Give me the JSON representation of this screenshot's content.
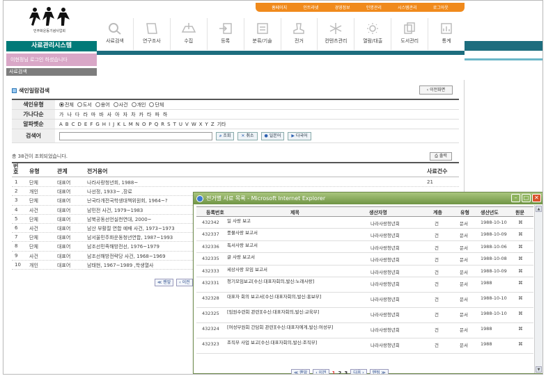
{
  "header": {
    "top_links": [
      "홈페이지",
      "인트라넷",
      "경영정보",
      "인명관리",
      "시스템관리",
      "로그아웃"
    ],
    "logo_caption": "민주화운동기념사업회",
    "system_title": "사료관리시스템",
    "welcome": "이현정님 로그인 하셨습니다",
    "sub_title": "사료검색",
    "nav_items": [
      {
        "label": "사료검색",
        "icon": "magnifier-icon"
      },
      {
        "label": "연구조사",
        "icon": "book-icon"
      },
      {
        "label": "수집",
        "icon": "tray-icon"
      },
      {
        "label": "등록",
        "icon": "import-icon"
      },
      {
        "label": "분류/기술",
        "icon": "sort-icon"
      },
      {
        "label": "전거",
        "icon": "stamp-icon"
      },
      {
        "label": "컨텐츠관리",
        "icon": "snowflake-icon"
      },
      {
        "label": "열람/대출",
        "icon": "sun-icon"
      },
      {
        "label": "도서관리",
        "icon": "books-icon"
      },
      {
        "label": "통계",
        "icon": "chart-icon"
      }
    ]
  },
  "search": {
    "section_title": "색인일람검색",
    "prev_button": "이전화면",
    "type_label": "색인유형",
    "type_options": [
      "전체",
      "도서",
      "용어",
      "사건",
      "개인",
      "단체"
    ],
    "hangul_label": "가나다순",
    "hangul": [
      "가",
      "나",
      "다",
      "라",
      "마",
      "바",
      "사",
      "아",
      "자",
      "차",
      "카",
      "타",
      "파",
      "하"
    ],
    "alpha_label": "알파벳순",
    "alpha": [
      "A",
      "B",
      "C",
      "D",
      "E",
      "F",
      "G",
      "H",
      "I",
      "J",
      "K",
      "L",
      "M",
      "N",
      "O",
      "P",
      "Q",
      "R",
      "S",
      "T",
      "U",
      "V",
      "W",
      "X",
      "Y",
      "Z",
      "기타"
    ],
    "keyword_label": "검색어",
    "buttons": [
      "조회",
      "취소",
      "일본어",
      "다국어"
    ]
  },
  "results": {
    "count_text": "총 38건이 조회되었습니다.",
    "print_button": "출력",
    "headers": [
      "번호",
      "유형",
      "관계",
      "전거용어",
      "사료건수"
    ],
    "rows": [
      [
        "1",
        "단체",
        "대표어",
        "나라사랑청년회, 1988~",
        "21"
      ],
      [
        "2",
        "개인",
        "대표어",
        "나선정, 1933~ ,장로",
        ""
      ],
      [
        "3",
        "단체",
        "대표어",
        "난국타개전국학생대책위원회, 1964~?",
        ""
      ],
      [
        "4",
        "사건",
        "대표어",
        "남민전 사건, 1979~1983",
        ""
      ],
      [
        "5",
        "단체",
        "대표어",
        "남북공동선언실천연대, 2000~",
        ""
      ],
      [
        "6",
        "사건",
        "대표어",
        "남산 부활절 연합 예배 사건, 1973~1973",
        ""
      ],
      [
        "7",
        "단체",
        "대표어",
        "남서울민주화운동청년연합, 1987~1993",
        ""
      ],
      [
        "8",
        "단체",
        "대표어",
        "남조선민족해방전선, 1976~1979",
        ""
      ],
      [
        "9",
        "사건",
        "대표어",
        "남조선해방전략당 사건, 1968~1969",
        ""
      ],
      [
        "10",
        "개인",
        "대표어",
        "남태현, 1967~1989 ,학생열사",
        ""
      ]
    ],
    "pager": [
      "맨앞",
      "이전"
    ]
  },
  "popup": {
    "title": "전거별 사료 목록 - Microsoft Internet Explorer",
    "headers": [
      "등록번호",
      "제목",
      "생산자명",
      "계층",
      "유형",
      "생산년도",
      "원문"
    ],
    "rows": [
      [
        "432342",
        "일 사랑 보고",
        "나라사랑청년회",
        "건",
        "문서",
        "1988-10-10",
        "⌘"
      ],
      [
        "432337",
        "풍물사랑 보고서",
        "나라사랑청년회",
        "건",
        "문서",
        "1988-10-09",
        "⌘"
      ],
      [
        "432336",
        "독서사랑 보고서",
        "나라사랑청년회",
        "건",
        "문서",
        "1988-10-06",
        "⌘"
      ],
      [
        "432335",
        "글 사랑 보고서",
        "나라사랑청년회",
        "건",
        "문서",
        "1988-10-08",
        "⌘"
      ],
      [
        "432333",
        "세상사랑 모임 보고서",
        "나라사랑청년회",
        "건",
        "문서",
        "1988-10-09",
        "⌘"
      ],
      [
        "432331",
        "청기모임보고[수신:대표자회의,발신:노래사랑]",
        "나라사랑청년회",
        "건",
        "문서",
        "1988",
        "⌘"
      ],
      [
        "432328",
        "대표자 회의 보고서[수신:대표자회의,발신:홍보부]",
        "나라사랑청년회",
        "건",
        "문서",
        "1988-10-10",
        "⌘"
      ],
      [
        "432325",
        "[임원수련회 관련][수신:대표자회의,발신:교육부]",
        "나라사랑청년회",
        "건",
        "문서",
        "1988-10-10",
        "⌘"
      ],
      [
        "432324",
        "[여성부원회 간담회 관련][수신:대표자에게,발신:여성부]",
        "나라사랑청년회",
        "건",
        "문서",
        "1988",
        "⌘"
      ],
      [
        "432323",
        "조직부 사업 보고[수신:대표자회의,발신:조직부]",
        "나라사랑청년회",
        "건",
        "문서",
        "1988",
        "⌘"
      ]
    ],
    "pager": {
      "first": "맨앞",
      "prev": "이전",
      "pages": [
        "1",
        "2",
        "3"
      ],
      "next": "다음",
      "last": "맨뒤"
    }
  }
}
